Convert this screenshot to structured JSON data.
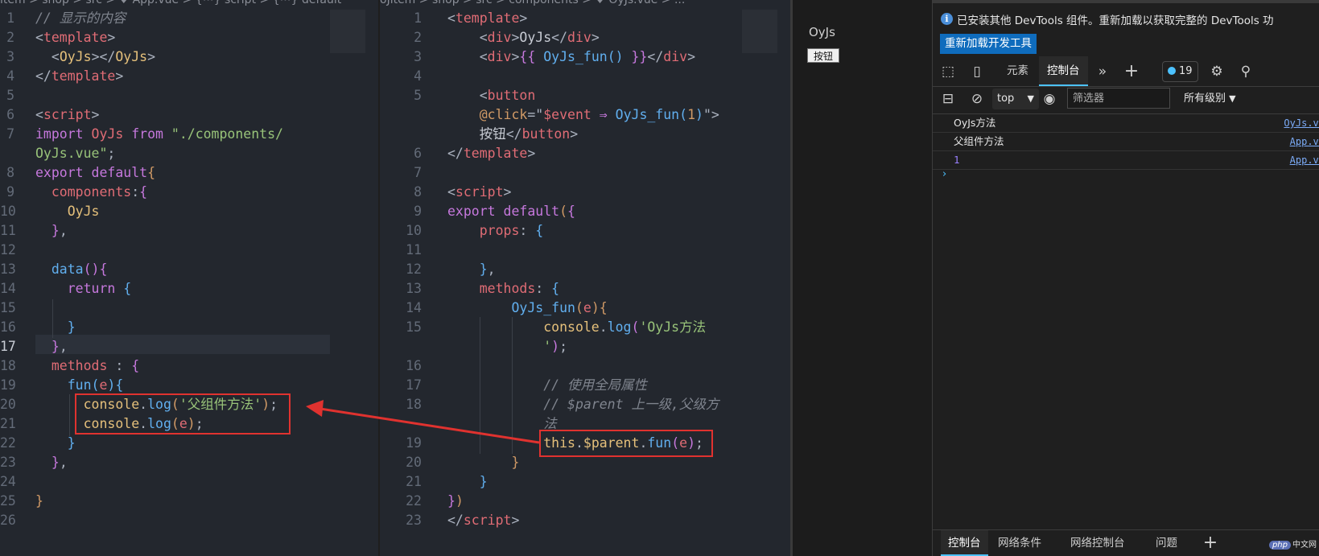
{
  "left_editor": {
    "breadcrumb": "item > shop > src > ♥ App.vue > {⋯} script > {⋯} default",
    "lines": [
      {
        "n": "1",
        "segs": [
          [
            "// 显示的内容",
            "t-com"
          ]
        ]
      },
      {
        "n": "2",
        "segs": [
          [
            "<",
            "t-punc"
          ],
          [
            "template",
            "t-tag"
          ],
          [
            ">",
            "t-punc"
          ]
        ]
      },
      {
        "n": "3",
        "segs": [
          [
            "  <",
            "t-punc"
          ],
          [
            "OyJs",
            "t-obj"
          ],
          [
            "></",
            "t-punc"
          ],
          [
            "OyJs",
            "t-obj"
          ],
          [
            ">",
            "t-punc"
          ]
        ]
      },
      {
        "n": "4",
        "segs": [
          [
            "</",
            "t-punc"
          ],
          [
            "template",
            "t-tag"
          ],
          [
            ">",
            "t-punc"
          ]
        ]
      },
      {
        "n": "5",
        "segs": []
      },
      {
        "n": "6",
        "segs": [
          [
            "<",
            "t-punc"
          ],
          [
            "script",
            "t-tag"
          ],
          [
            ">",
            "t-punc"
          ]
        ]
      },
      {
        "n": "7",
        "segs": [
          [
            "import ",
            "t-kw"
          ],
          [
            "OyJs ",
            "t-var"
          ],
          [
            "from ",
            "t-kw"
          ],
          [
            "\"./components/",
            "t-str"
          ]
        ]
      },
      {
        "n": "",
        "segs": [
          [
            "OyJs.vue",
            "t-str"
          ],
          [
            "\"",
            "t-str"
          ],
          [
            ";",
            "t-punc"
          ]
        ]
      },
      {
        "n": "8",
        "segs": [
          [
            "export ",
            "t-kw"
          ],
          [
            "default",
            "t-kw"
          ],
          [
            "{",
            "t-b1"
          ]
        ]
      },
      {
        "n": "9",
        "segs": [
          [
            "  components",
            "t-prop"
          ],
          [
            ":",
            "t-punc"
          ],
          [
            "{",
            "t-b2"
          ]
        ]
      },
      {
        "n": "10",
        "segs": [
          [
            "    OyJs",
            "t-obj"
          ]
        ]
      },
      {
        "n": "11",
        "segs": [
          [
            "  }",
            "t-b2"
          ],
          [
            ",",
            "t-punc"
          ]
        ]
      },
      {
        "n": "12",
        "segs": []
      },
      {
        "n": "13",
        "segs": [
          [
            "  data",
            "t-fn"
          ],
          [
            "()",
            "t-b2"
          ],
          [
            "{",
            "t-b2"
          ]
        ]
      },
      {
        "n": "14",
        "segs": [
          [
            "    return ",
            "t-kw"
          ],
          [
            "{",
            "t-b3"
          ]
        ]
      },
      {
        "n": "15",
        "segs": []
      },
      {
        "n": "16",
        "segs": [
          [
            "    }",
            "t-b3"
          ]
        ]
      },
      {
        "n": "17",
        "segs": [
          [
            "  }",
            "t-b2"
          ],
          [
            ",",
            "t-punc"
          ]
        ],
        "active": true
      },
      {
        "n": "18",
        "segs": [
          [
            "  methods ",
            "t-prop"
          ],
          [
            ": ",
            "t-punc"
          ],
          [
            "{",
            "t-b2"
          ]
        ]
      },
      {
        "n": "19",
        "segs": [
          [
            "    fun",
            "t-fn"
          ],
          [
            "(",
            "t-b3"
          ],
          [
            "e",
            "t-var"
          ],
          [
            ")",
            "t-b3"
          ],
          [
            "{",
            "t-b3"
          ]
        ]
      },
      {
        "n": "20",
        "segs": [
          [
            "      console",
            "t-obj"
          ],
          [
            ".",
            "t-punc"
          ],
          [
            "log",
            "t-fn"
          ],
          [
            "(",
            "t-b1"
          ],
          [
            "'父组件方法'",
            "t-str"
          ],
          [
            ")",
            "t-b1"
          ],
          [
            ";",
            "t-punc"
          ]
        ]
      },
      {
        "n": "21",
        "segs": [
          [
            "      console",
            "t-obj"
          ],
          [
            ".",
            "t-punc"
          ],
          [
            "log",
            "t-fn"
          ],
          [
            "(",
            "t-b1"
          ],
          [
            "e",
            "t-var"
          ],
          [
            ")",
            "t-b1"
          ],
          [
            ";",
            "t-punc"
          ]
        ]
      },
      {
        "n": "22",
        "segs": [
          [
            "    }",
            "t-b3"
          ]
        ]
      },
      {
        "n": "23",
        "segs": [
          [
            "  }",
            "t-b2"
          ],
          [
            ",",
            "t-punc"
          ]
        ]
      },
      {
        "n": "24",
        "segs": []
      },
      {
        "n": "25",
        "segs": [
          [
            "}",
            "t-b1"
          ]
        ]
      },
      {
        "n": "26",
        "segs": []
      }
    ]
  },
  "mid_editor": {
    "breadcrumb": "oJitem > shop > src > components > ♥ OyJs.vue > ...",
    "lines": [
      {
        "n": "1",
        "segs": [
          [
            "<",
            "t-punc"
          ],
          [
            "template",
            "t-tag"
          ],
          [
            ">",
            "t-punc"
          ]
        ]
      },
      {
        "n": "2",
        "segs": [
          [
            "    <",
            "t-punc"
          ],
          [
            "div",
            "t-tag"
          ],
          [
            ">",
            "t-punc"
          ],
          [
            "OyJs",
            "t-pl"
          ],
          [
            "</",
            "t-punc"
          ],
          [
            "div",
            "t-tag"
          ],
          [
            ">",
            "t-punc"
          ]
        ]
      },
      {
        "n": "3",
        "segs": [
          [
            "    <",
            "t-punc"
          ],
          [
            "div",
            "t-tag"
          ],
          [
            ">",
            "t-punc"
          ],
          [
            "{{ ",
            "t-b2"
          ],
          [
            "OyJs_fun",
            "t-fn"
          ],
          [
            "() ",
            "t-b3"
          ],
          [
            "}}",
            "t-b2"
          ],
          [
            "</",
            "t-punc"
          ],
          [
            "div",
            "t-tag"
          ],
          [
            ">",
            "t-punc"
          ]
        ]
      },
      {
        "n": "4",
        "segs": []
      },
      {
        "n": "5",
        "segs": [
          [
            "    <",
            "t-punc"
          ],
          [
            "button",
            "t-tag"
          ]
        ]
      },
      {
        "n": "",
        "segs": [
          [
            "    @click",
            "t-p"
          ],
          [
            "=\"",
            "t-punc"
          ],
          [
            "$event ",
            "t-var"
          ],
          [
            "⇒ ",
            "t-kw"
          ],
          [
            "OyJs_fun",
            "t-fn"
          ],
          [
            "(",
            "t-b3"
          ],
          [
            "1",
            "t-num"
          ],
          [
            ")",
            "t-b3"
          ],
          [
            "\">",
            "t-punc"
          ]
        ]
      },
      {
        "n": "",
        "segs": [
          [
            "    按钮",
            "t-pl"
          ],
          [
            "</",
            "t-punc"
          ],
          [
            "button",
            "t-tag"
          ],
          [
            ">",
            "t-punc"
          ]
        ]
      },
      {
        "n": "6",
        "segs": [
          [
            "</",
            "t-punc"
          ],
          [
            "template",
            "t-tag"
          ],
          [
            ">",
            "t-punc"
          ]
        ]
      },
      {
        "n": "7",
        "segs": []
      },
      {
        "n": "8",
        "segs": [
          [
            "<",
            "t-punc"
          ],
          [
            "script",
            "t-tag"
          ],
          [
            ">",
            "t-punc"
          ]
        ]
      },
      {
        "n": "9",
        "segs": [
          [
            "export ",
            "t-kw"
          ],
          [
            "default",
            "t-kw"
          ],
          [
            "(",
            "t-b1"
          ],
          [
            "{",
            "t-b2"
          ]
        ]
      },
      {
        "n": "10",
        "segs": [
          [
            "    props",
            "t-prop"
          ],
          [
            ": ",
            "t-punc"
          ],
          [
            "{",
            "t-b3"
          ]
        ]
      },
      {
        "n": "11",
        "segs": []
      },
      {
        "n": "12",
        "segs": [
          [
            "    }",
            "t-b3"
          ],
          [
            ",",
            "t-punc"
          ]
        ]
      },
      {
        "n": "13",
        "segs": [
          [
            "    methods",
            "t-prop"
          ],
          [
            ": ",
            "t-punc"
          ],
          [
            "{",
            "t-b3"
          ]
        ]
      },
      {
        "n": "14",
        "segs": [
          [
            "        OyJs_fun",
            "t-fn"
          ],
          [
            "(",
            "t-b1"
          ],
          [
            "e",
            "t-var"
          ],
          [
            ")",
            "t-b1"
          ],
          [
            "{",
            "t-b1"
          ]
        ]
      },
      {
        "n": "15",
        "segs": [
          [
            "            console",
            "t-obj"
          ],
          [
            ".",
            "t-punc"
          ],
          [
            "log",
            "t-fn"
          ],
          [
            "(",
            "t-b2"
          ],
          [
            "'OyJs方法",
            "t-str"
          ]
        ]
      },
      {
        "n": "",
        "segs": [
          [
            "            '",
            "t-str"
          ],
          [
            ")",
            "t-b2"
          ],
          [
            ";",
            "t-punc"
          ]
        ]
      },
      {
        "n": "16",
        "segs": []
      },
      {
        "n": "17",
        "segs": [
          [
            "            // 使用全局属性",
            "t-com"
          ]
        ]
      },
      {
        "n": "18",
        "segs": [
          [
            "            // $parent 上一级,父级方",
            "t-com"
          ]
        ]
      },
      {
        "n": "",
        "segs": [
          [
            "            法",
            "t-com"
          ]
        ]
      },
      {
        "n": "19",
        "segs": [
          [
            "            this",
            "t-obj"
          ],
          [
            ".",
            "t-punc"
          ],
          [
            "$parent",
            "t-obj"
          ],
          [
            ".",
            "t-punc"
          ],
          [
            "fun",
            "t-fn"
          ],
          [
            "(",
            "t-b2"
          ],
          [
            "e",
            "t-var"
          ],
          [
            ")",
            "t-b2"
          ],
          [
            ";",
            "t-punc"
          ]
        ]
      },
      {
        "n": "20",
        "segs": [
          [
            "        }",
            "t-b1"
          ]
        ]
      },
      {
        "n": "21",
        "segs": [
          [
            "    }",
            "t-b3"
          ]
        ]
      },
      {
        "n": "22",
        "segs": [
          [
            "}",
            "t-b2"
          ],
          [
            ")",
            "t-b1"
          ]
        ]
      },
      {
        "n": "23",
        "segs": [
          [
            "</",
            "t-punc"
          ],
          [
            "script",
            "t-tag"
          ],
          [
            ">",
            "t-punc"
          ]
        ]
      }
    ]
  },
  "browser": {
    "text": "OyJs",
    "button_label": "按钮"
  },
  "devtools": {
    "info_message": "已安装其他 DevTools 组件。重新加载以获取完整的 DevTools 功",
    "reload_button": "重新加载开发工具",
    "tabs": [
      "元素",
      "控制台"
    ],
    "active_tab": "控制台",
    "message_count": "19",
    "context": "top",
    "filter_placeholder": "筛选器",
    "levels_label": "所有级别",
    "console_rows": [
      {
        "message": "OyJs方法",
        "source": "OyJs.vu",
        "numeric": false
      },
      {
        "message": "父组件方法",
        "source": "App.vu",
        "numeric": false
      },
      {
        "message": "1",
        "source": "App.vu",
        "numeric": true
      }
    ],
    "prompt": "›",
    "bottom_tabs": [
      "控制台",
      "网络条件",
      "网络控制台",
      "问题"
    ],
    "active_bottom_tab": "控制台",
    "watermark": "中文网",
    "watermark_logo": "php"
  },
  "colors": {
    "highlight_box": "#e0322f",
    "accent": "#4cc2ff",
    "reload_button_bg": "#0f6cbd"
  }
}
